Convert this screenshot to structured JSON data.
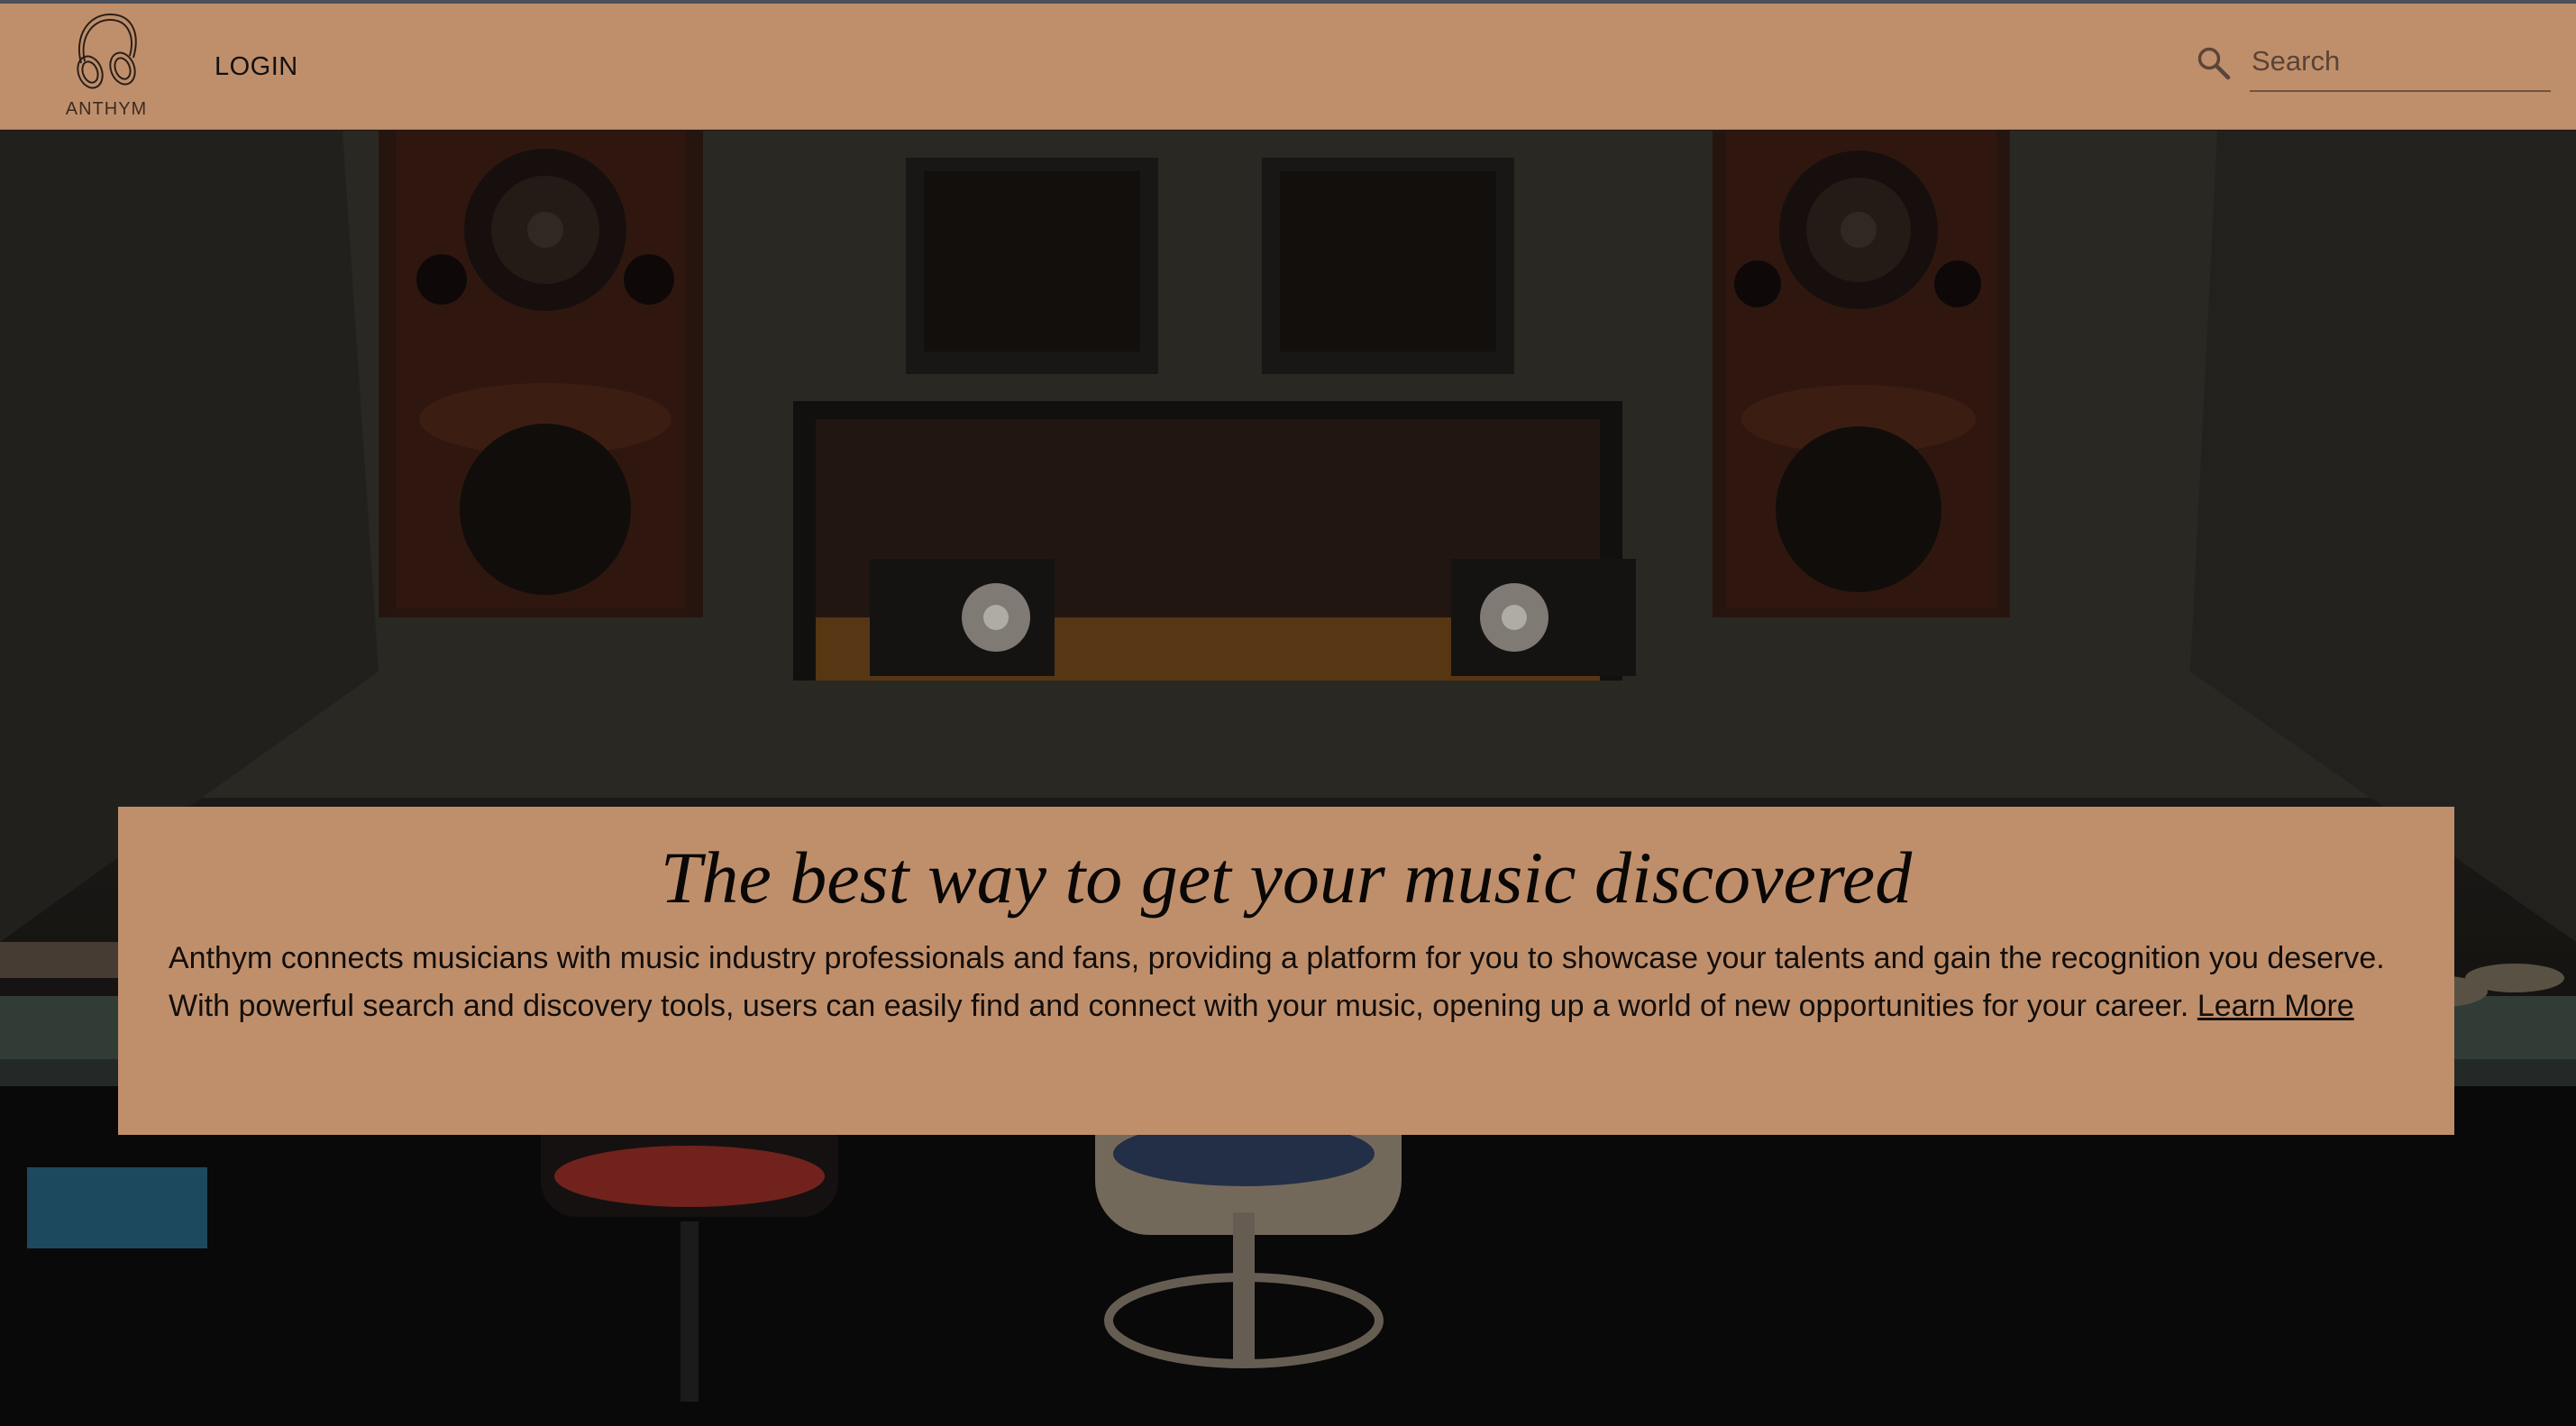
{
  "brand": {
    "name": "ANTHYM",
    "logo_icon": "headphones-icon"
  },
  "nav": {
    "login_label": "LOGIN"
  },
  "search": {
    "placeholder": "Search",
    "value": "",
    "icon": "search-icon"
  },
  "hero": {
    "background": "recording-studio-photo",
    "title": "The best way to get your music discovered",
    "body": "Anthym connects musicians with music industry professionals and fans, providing a platform for you to showcase your talents and gain the recognition you deserve. With powerful search and discovery tools, users can easily find and connect with your music, opening up a world of new opportunities for your career.",
    "learn_more_label": "Learn More"
  },
  "colors": {
    "accent": "#bf8f6c",
    "text": "#141010",
    "hero_overlay": "#1a1410"
  }
}
